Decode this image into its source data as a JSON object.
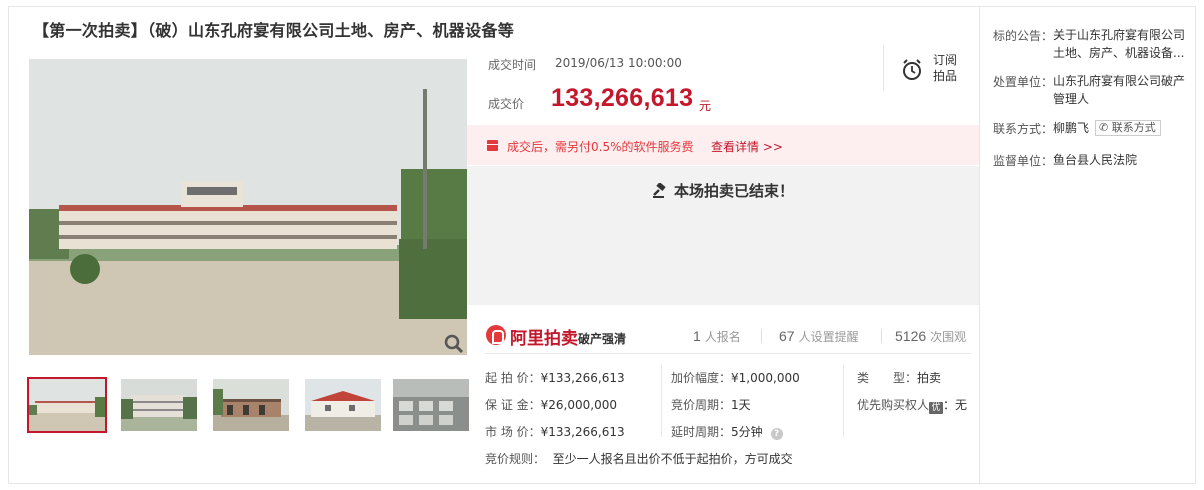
{
  "title": "【第一次拍卖】（破）山东孔府宴有限公司土地、房产、机器设备等",
  "deal": {
    "time_label": "成交时间",
    "time_value": "2019/06/13 10:00:00",
    "price_label": "成交价",
    "price_value": "133,266,613",
    "price_unit": "元"
  },
  "subscribe": {
    "label": "订阅拍品",
    "icon": "alarm-clock-icon"
  },
  "fee_notice": {
    "text_before": "成交后，需另付",
    "rate": "0.5%",
    "text_after": "的软件服务费",
    "link": "查看详情 >>",
    "icon": "gift-icon"
  },
  "status": {
    "ended": "本场拍卖已结束！",
    "icon": "gavel-icon"
  },
  "platform": {
    "name": "阿里拍卖",
    "tag": "破产强清"
  },
  "stats": {
    "signups_num": "1",
    "signups_label": "人报名",
    "reminders_num": "67",
    "reminders_label": "人设置提醒",
    "viewers_num": "5126",
    "viewers_label": "次围观"
  },
  "details": {
    "start_price_label": "起 拍 价：",
    "start_price": "¥133,266,613",
    "deposit_label": "保 证 金：",
    "deposit": "¥26,000,000",
    "market_price_label": "市 场 价：",
    "market_price": "¥133,266,613",
    "increment_label": "加价幅度：",
    "increment": "¥1,000,000",
    "cycle_label": "竞价周期：",
    "cycle": "1天",
    "delay_label": "延时周期：",
    "delay": "5分钟",
    "type_label": "类　　型：",
    "type": "拍卖",
    "priority_label": "优先购买权人",
    "priority_badge": "优",
    "priority_value": "：无",
    "rules_label": "竞价规则：",
    "rules": "至少一人报名且出价不低于起拍价，方可成交"
  },
  "sidebar": {
    "announcement_label": "标的公告：",
    "announcement_value": "关于山东孔府宴有限公司土地、房产、机器设备...",
    "disposer_label": "处置单位：",
    "disposer_value": "山东孔府宴有限公司破产管理人",
    "contact_label": "联系方式：",
    "contact_name": "柳鹏飞",
    "contact_button": "联系方式",
    "supervisor_label": "监督单位：",
    "supervisor_value": "鱼台县人民法院"
  },
  "colors": {
    "accent": "#c3172b",
    "fee_bg": "#fdeef0",
    "ended_bg": "#f2f2f2"
  }
}
